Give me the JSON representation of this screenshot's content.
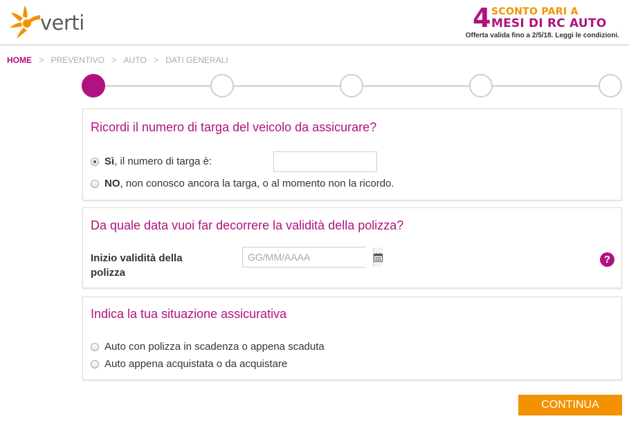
{
  "header": {
    "logo_text": "verti",
    "promo": {
      "number": "4",
      "line1": "SCONTO PARI A",
      "line2": "MESI DI RC AUTO",
      "note": "Offerta valida fino a 2/5/18. Leggi le condizioni."
    }
  },
  "breadcrumb": {
    "items": [
      "HOME",
      "PREVENTIVO",
      "AUTO",
      "DATI GENERALI"
    ],
    "separator": ">"
  },
  "stepper": {
    "total_steps": 5,
    "current_step": 1
  },
  "plate_section": {
    "title": "Ricordi il numero di targa del veicolo da assicurare?",
    "option_yes_strong": "Sì",
    "option_yes_text": ", il numero di targa è:",
    "option_no_strong": "NO",
    "option_no_text": ", non conosco ancora la targa, o al momento non la ricordo.",
    "plate_value": ""
  },
  "date_section": {
    "title": "Da quale data vuoi far decorrere la validità della polizza?",
    "label": "Inizio validità della polizza",
    "placeholder": "GG/MM/AAAA",
    "help_symbol": "?"
  },
  "insurance_section": {
    "title": "Indica la tua situazione assicurativa",
    "options": [
      "Auto con polizza in scadenza o appena scaduta",
      "Auto appena acquistata o da acquistare"
    ]
  },
  "actions": {
    "continue_label": "CONTINUA"
  },
  "colors": {
    "brand_magenta": "#b0127f",
    "brand_orange": "#f39200"
  },
  "icons": {
    "logo": "verti-star-logo-icon",
    "calendar": "calendar-icon",
    "help": "help-icon"
  }
}
